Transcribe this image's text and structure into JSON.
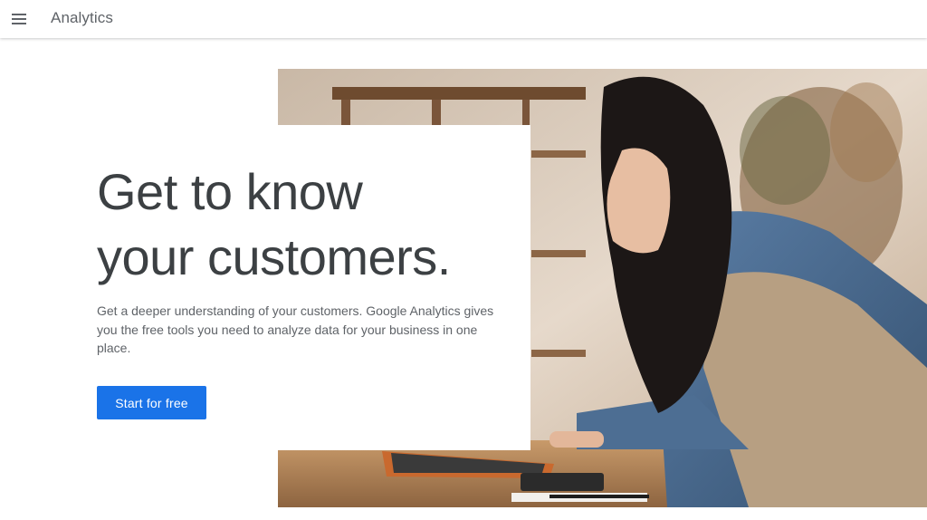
{
  "header": {
    "menu_icon": "hamburger-menu-icon",
    "brand": "Analytics"
  },
  "hero": {
    "headline_line1": "Get to know",
    "headline_line2": "your customers.",
    "description": "Get a deeper understanding of your customers. Google Analytics gives you the free tools you need to analyze data for your business in one place.",
    "cta_label": "Start for free",
    "image_subject": "woman-working-on-laptop"
  },
  "colors": {
    "accent": "#1a73e8",
    "headline": "#3c4043",
    "body_text": "#5f6368"
  }
}
